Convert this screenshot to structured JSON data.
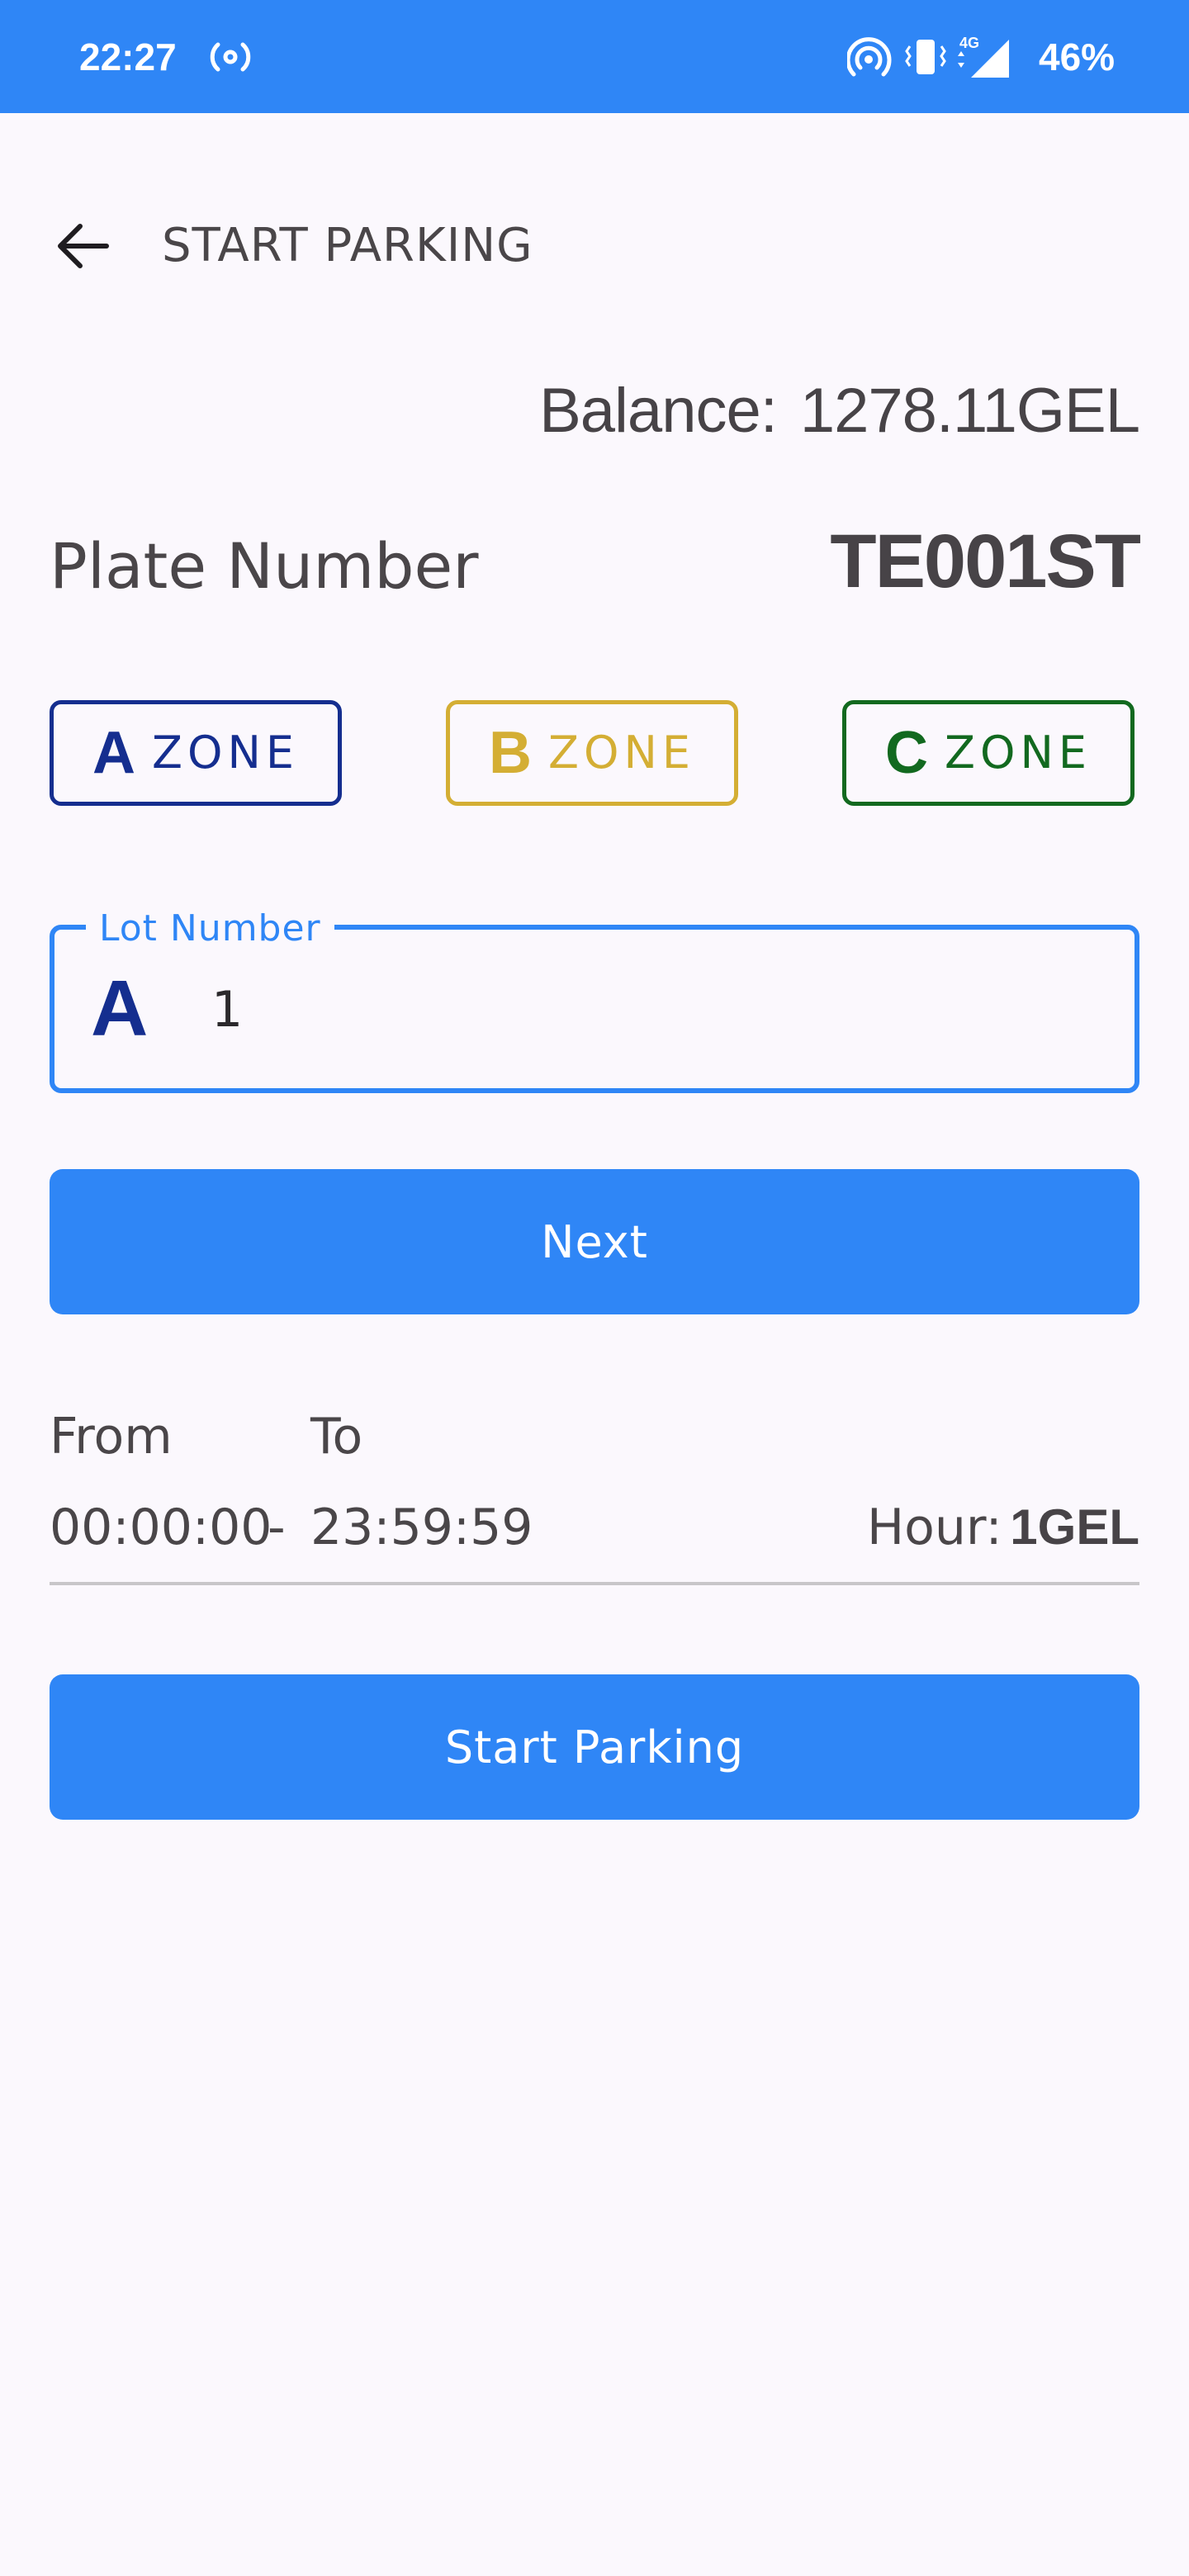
{
  "status_bar": {
    "time": "22:27",
    "battery": "46%",
    "network": "4G",
    "icons": [
      "radio-icon",
      "hotspot-icon",
      "vibrate-icon",
      "signal-icon"
    ]
  },
  "header": {
    "title": "START PARKING",
    "back_icon": "arrow-left-icon"
  },
  "balance": {
    "label": "Balance:",
    "value": "1278.11GEL"
  },
  "plate": {
    "label": "Plate Number",
    "value": "TE001ST"
  },
  "zones": [
    {
      "letter": "A",
      "label": "ZONE",
      "color": "#152e8f"
    },
    {
      "letter": "B",
      "label": "ZONE",
      "color": "#d4ae34"
    },
    {
      "letter": "C",
      "label": "ZONE",
      "color": "#12691f"
    }
  ],
  "lot": {
    "label": "Lot Number",
    "zone_prefix": "A",
    "value": "1"
  },
  "buttons": {
    "next": "Next",
    "start_parking": "Start Parking"
  },
  "schedule": {
    "from_label": "From",
    "to_label": "To",
    "from_value": "00:00:00",
    "separator": "-",
    "to_value": "23:59:59",
    "hour_label": "Hour:",
    "hour_price": "1GEL"
  },
  "colors": {
    "accent": "#2f86f6",
    "background": "#fbf8fd"
  }
}
